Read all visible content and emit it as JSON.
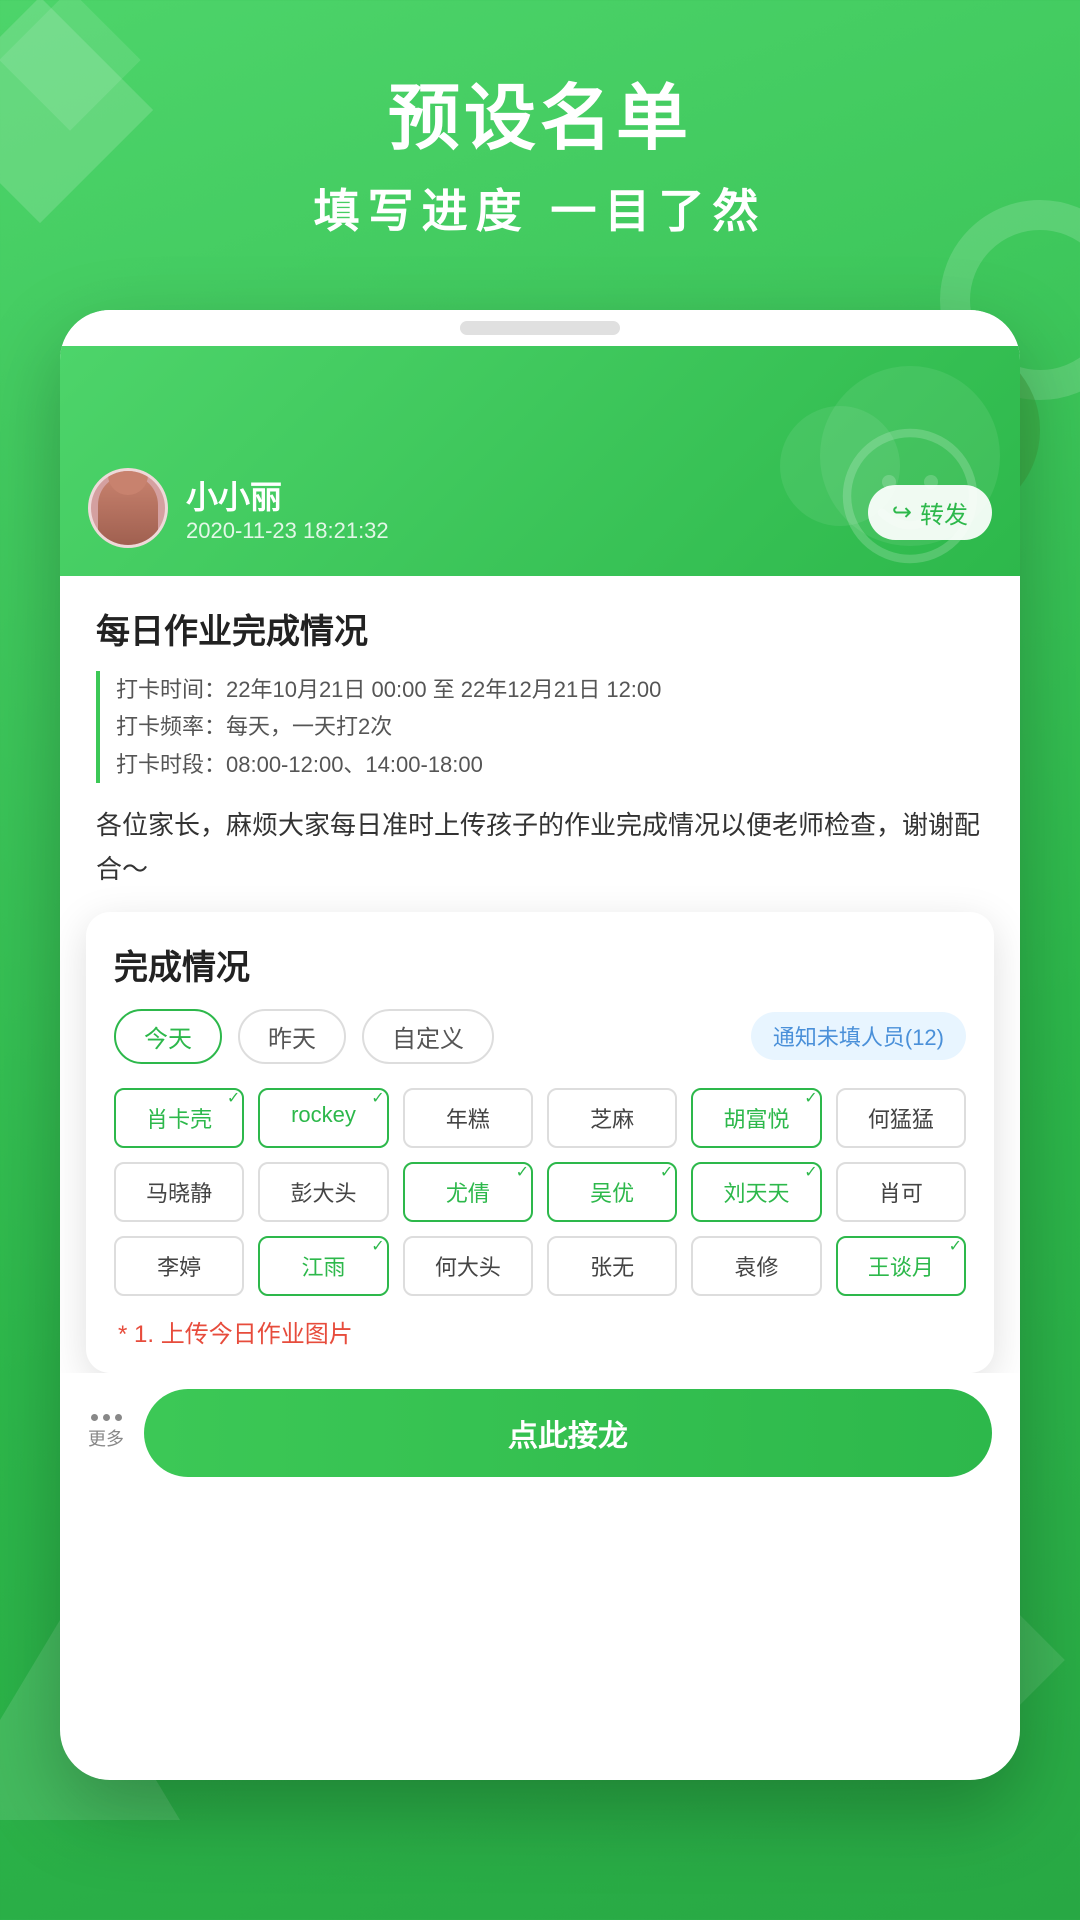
{
  "header": {
    "title": "预设名单",
    "subtitle": "填写进度 一目了然"
  },
  "app": {
    "user": {
      "name": "小小丽",
      "time": "2020-11-23 18:21:32",
      "forward_btn": "转发"
    },
    "content": {
      "title": "每日作业完成情况",
      "info_lines": [
        "打卡时间：22年10月21日 00:00 至 22年12月21日 12:00",
        "打卡频率：每天，一天打2次",
        "打卡时段：08:00-12:00、14:00-18:00"
      ],
      "description": "各位家长，麻烦大家每日准时上传孩子的作业完成情况以便老师检查，谢谢配合～"
    },
    "completion": {
      "title": "完成情况",
      "filters": [
        "今天",
        "昨天",
        "自定义"
      ],
      "active_filter": "今天",
      "notify_btn": "通知未填人员(12)",
      "names": [
        {
          "name": "肖卡壳",
          "checked": true
        },
        {
          "name": "rockey",
          "checked": true
        },
        {
          "name": "年糕",
          "checked": false
        },
        {
          "name": "芝麻",
          "checked": false
        },
        {
          "name": "胡富悦",
          "checked": true
        },
        {
          "name": "何猛猛",
          "checked": false
        },
        {
          "name": "马晓静",
          "checked": false
        },
        {
          "name": "彭大头",
          "checked": false
        },
        {
          "name": "尤倩",
          "checked": true
        },
        {
          "name": "吴优",
          "checked": true
        },
        {
          "name": "刘天天",
          "checked": true
        },
        {
          "name": "肖可",
          "checked": false
        },
        {
          "name": "李婷",
          "checked": false
        },
        {
          "name": "江雨",
          "checked": true
        },
        {
          "name": "何大头",
          "checked": false
        },
        {
          "name": "张无",
          "checked": false
        },
        {
          "name": "袁修",
          "checked": false
        },
        {
          "name": "王谈月",
          "checked": true
        }
      ]
    },
    "upload_note": "* 1. 上传今日作业图片",
    "more_label": "更多",
    "submit_btn": "点此接龙"
  }
}
